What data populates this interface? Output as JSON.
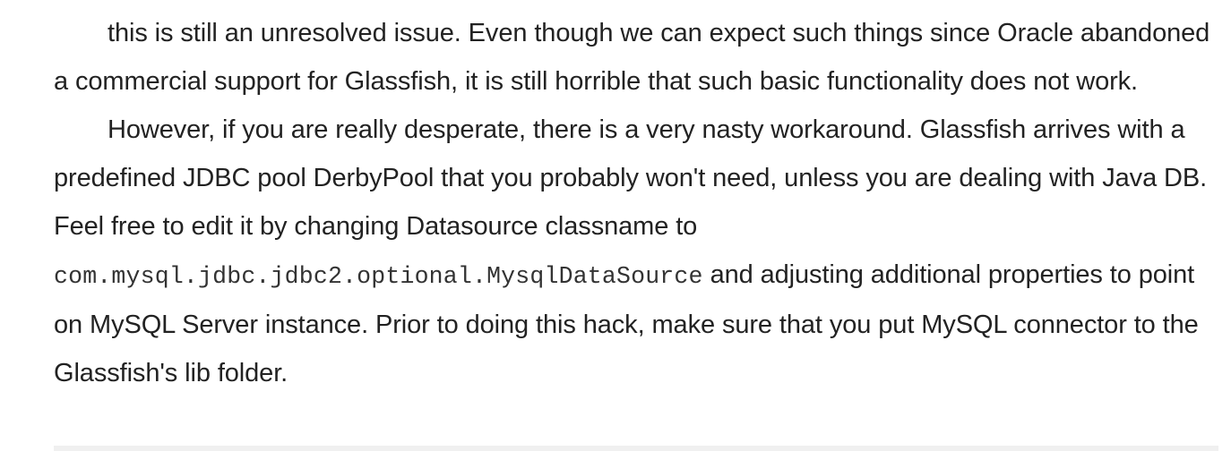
{
  "article": {
    "paragraph_1": "this is still an unresolved issue. Even though we can expect such things since Oracle abandoned a commercial support for Glassfish, it is still horrible that such basic functionality does not work.",
    "paragraph_2": {
      "text_before_code": "However, if you are really desperate, there is a very nasty workaround. Glassfish arrives with a predefined JDBC pool DerbyPool that you probably won't need, unless you are dealing with Java DB. Feel free to edit it by changing Datasource classname to",
      "code": "com.mysql.jdbc.jdbc2.optional.MysqlDataSource",
      "text_after_code": " and adjusting additional properties to point on MySQL Server instance. Prior to doing this hack, make sure that you put MySQL connector to the Glassfish's lib folder."
    }
  }
}
